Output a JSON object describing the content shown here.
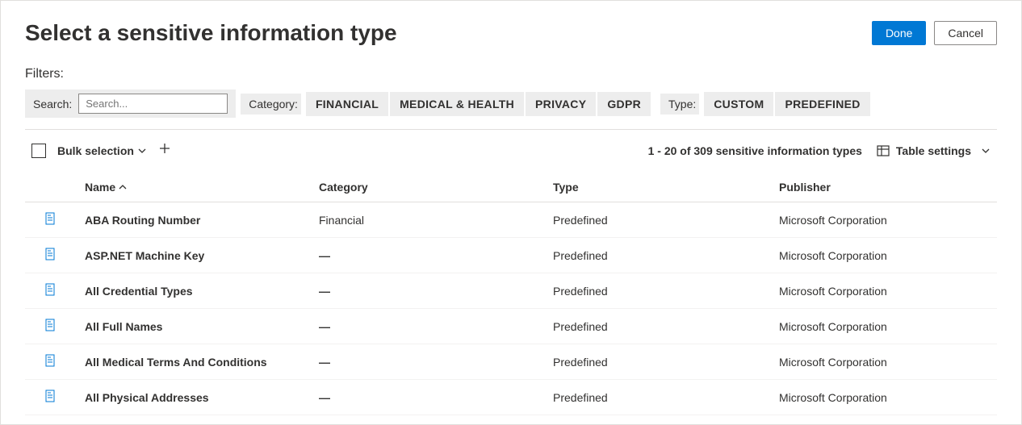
{
  "header": {
    "title": "Select a sensitive information type",
    "done": "Done",
    "cancel": "Cancel"
  },
  "filters": {
    "label": "Filters:",
    "search_label": "Search:",
    "search_placeholder": "Search...",
    "category_label": "Category:",
    "category_options": [
      "FINANCIAL",
      "MEDICAL & HEALTH",
      "PRIVACY",
      "GDPR"
    ],
    "type_label": "Type:",
    "type_options": [
      "CUSTOM",
      "PREDEFINED"
    ]
  },
  "toolbar": {
    "bulk_selection": "Bulk selection",
    "count_text": "1 - 20 of 309 sensitive information types",
    "table_settings": "Table settings"
  },
  "columns": {
    "name": "Name",
    "category": "Category",
    "type": "Type",
    "publisher": "Publisher"
  },
  "rows": [
    {
      "name": "ABA Routing Number",
      "category": "Financial",
      "type": "Predefined",
      "publisher": "Microsoft Corporation"
    },
    {
      "name": "ASP.NET Machine Key",
      "category": "—",
      "type": "Predefined",
      "publisher": "Microsoft Corporation"
    },
    {
      "name": "All Credential Types",
      "category": "—",
      "type": "Predefined",
      "publisher": "Microsoft Corporation"
    },
    {
      "name": "All Full Names",
      "category": "—",
      "type": "Predefined",
      "publisher": "Microsoft Corporation"
    },
    {
      "name": "All Medical Terms And Conditions",
      "category": "—",
      "type": "Predefined",
      "publisher": "Microsoft Corporation"
    },
    {
      "name": "All Physical Addresses",
      "category": "—",
      "type": "Predefined",
      "publisher": "Microsoft Corporation"
    }
  ]
}
